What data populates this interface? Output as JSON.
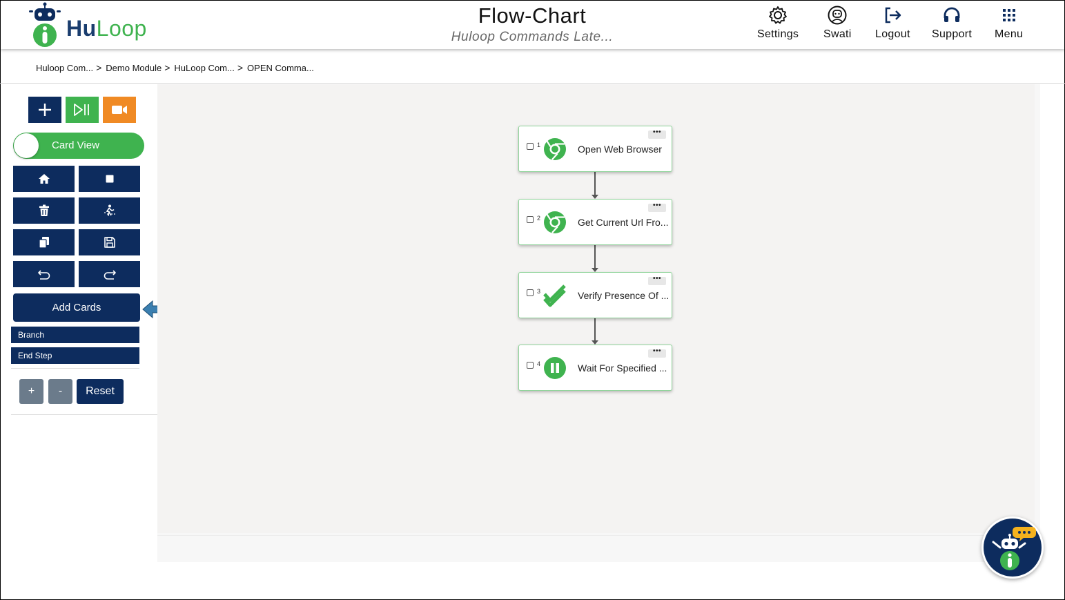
{
  "brand": {
    "name_part1": "Hu",
    "name_part2": "Loop"
  },
  "header": {
    "title": "Flow-Chart",
    "subtitle": "Huloop Commands Late..."
  },
  "nav": [
    {
      "label": "Settings",
      "icon": "gear-icon"
    },
    {
      "label": "Swati",
      "icon": "user-icon"
    },
    {
      "label": "Logout",
      "icon": "logout-icon"
    },
    {
      "label": "Support",
      "icon": "headset-icon"
    },
    {
      "label": "Menu",
      "icon": "grid-icon"
    }
  ],
  "breadcrumb": [
    "Huloop Com...",
    "Demo Module",
    "HuLoop Com...",
    "OPEN Comma..."
  ],
  "toolbar": {
    "add": "add-icon",
    "run": "play-pause-icon",
    "record": "video-camera-icon"
  },
  "toggle": {
    "label": "Card View"
  },
  "tools": [
    {
      "icon": "home-icon"
    },
    {
      "icon": "stop-icon"
    },
    {
      "icon": "trash-icon"
    },
    {
      "icon": "run-step-icon"
    },
    {
      "icon": "copy-icon"
    },
    {
      "icon": "save-icon"
    },
    {
      "icon": "undo-icon"
    },
    {
      "icon": "redo-icon"
    }
  ],
  "add_cards_label": "Add Cards",
  "list_buttons": [
    "Branch",
    "End Step"
  ],
  "zoom": {
    "plus": "+",
    "minus": "-",
    "reset": "Reset"
  },
  "more_label": "•••",
  "cards": [
    {
      "num": "1",
      "label": "Open Web Browser",
      "icon": "chrome-icon"
    },
    {
      "num": "2",
      "label": "Get Current Url Fro...",
      "icon": "chrome-icon"
    },
    {
      "num": "3",
      "label": "Verify Presence Of ...",
      "icon": "checkmark-icon"
    },
    {
      "num": "4",
      "label": "Wait For Specified ...",
      "icon": "pause-icon"
    }
  ],
  "colors": {
    "navy": "#0d2c5e",
    "green": "#3fb34f",
    "orange": "#f08a24",
    "card_border": "#8fd49a"
  }
}
